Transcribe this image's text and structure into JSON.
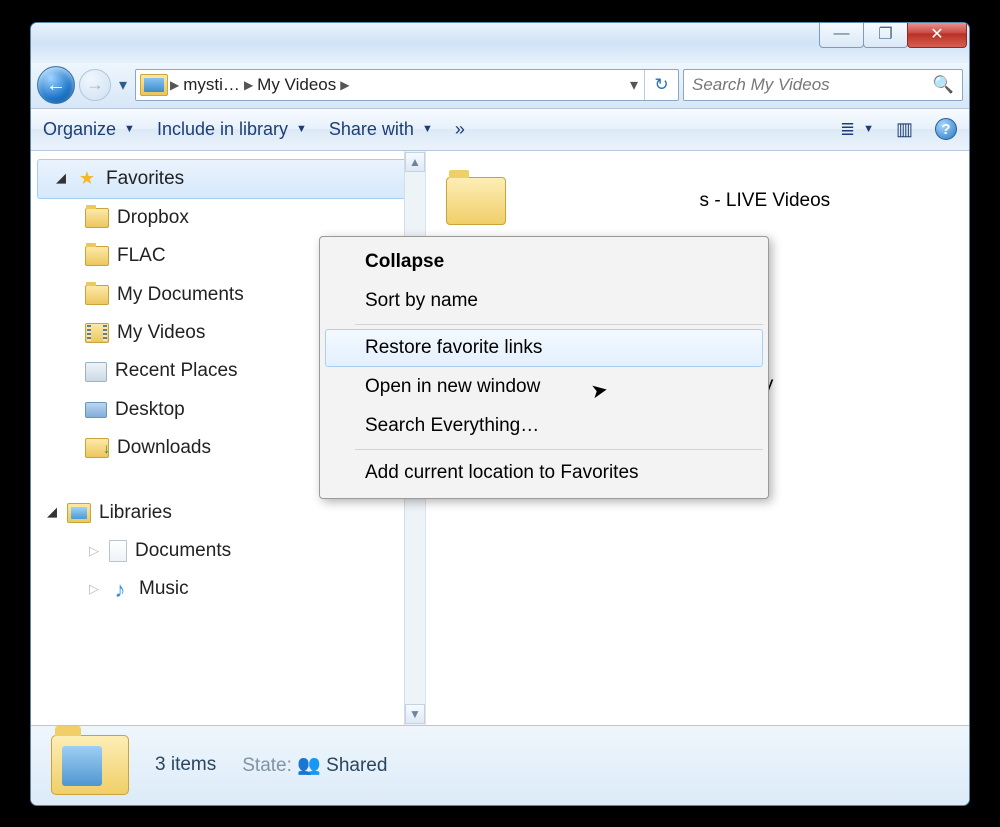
{
  "titlebar": {
    "minimize": "—",
    "maximize": "❐",
    "close": "✕"
  },
  "nav": {
    "back": "←",
    "forward": "→",
    "drop": "▾",
    "breadcrumb": [
      {
        "label": "mysti…"
      },
      {
        "label": "My Videos"
      }
    ],
    "addr_drop": "▾",
    "refresh": "↻"
  },
  "search": {
    "placeholder": "Search My Videos",
    "icon": "🔍"
  },
  "toolbar": {
    "organize": "Organize",
    "include": "Include in library",
    "share": "Share with",
    "more": "»",
    "viewopts": "≣",
    "preview": "▥",
    "help": "?"
  },
  "sidebar": {
    "favorites": {
      "label": "Favorites",
      "items": [
        {
          "label": "Dropbox",
          "icon": "folder"
        },
        {
          "label": "FLAC",
          "icon": "folder"
        },
        {
          "label": "My Documents",
          "icon": "folder"
        },
        {
          "label": "My Videos",
          "icon": "vid"
        },
        {
          "label": "Recent Places",
          "icon": "rec"
        },
        {
          "label": "Desktop",
          "icon": "desk"
        },
        {
          "label": "Downloads",
          "icon": "dl"
        }
      ]
    },
    "libraries": {
      "label": "Libraries",
      "items": [
        {
          "label": "Documents",
          "icon": "doc"
        },
        {
          "label": "Music",
          "icon": "mus"
        }
      ]
    }
  },
  "context_menu": {
    "collapse": "Collapse",
    "sort": "Sort by name",
    "restore": "Restore favorite links",
    "open": "Open in new window",
    "search": "Search Everything…",
    "add": "Add current location to Favorites"
  },
  "content": {
    "item1_suffix": "s - LIVE Videos",
    "item2_suffix": "OV"
  },
  "status": {
    "count": "3 items",
    "state_label": "State:",
    "state_value": "Shared",
    "people": "👥"
  }
}
